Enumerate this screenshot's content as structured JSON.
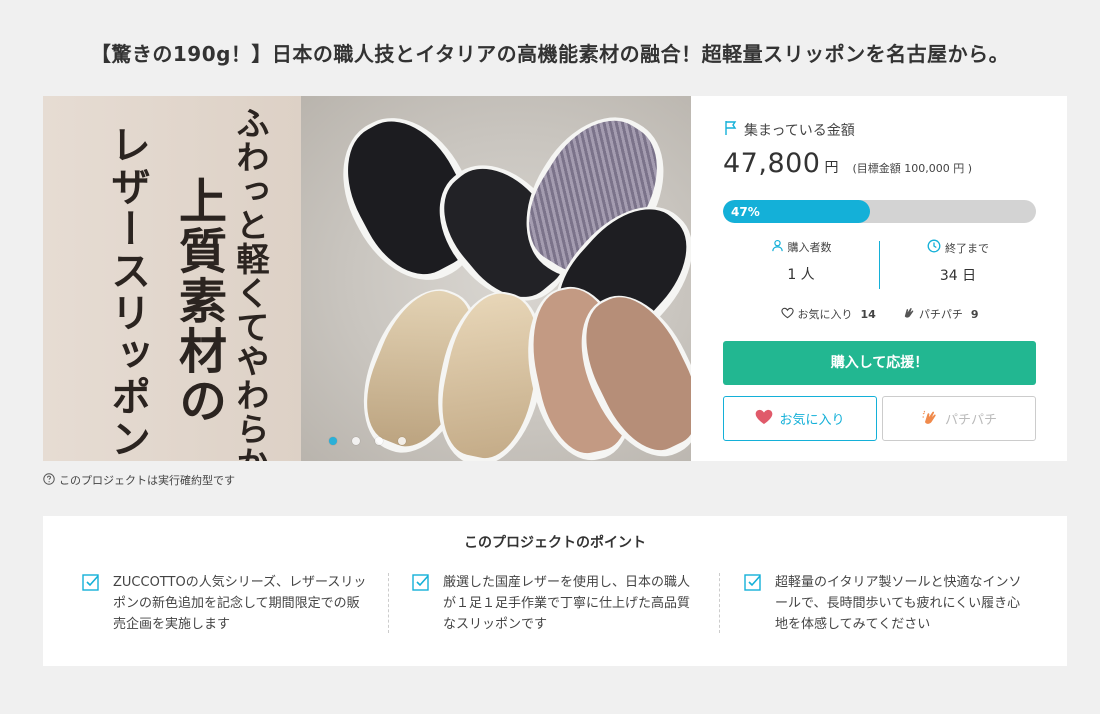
{
  "page_title": "【驚きの190g！】日本の職人技とイタリアの高機能素材の融合！超軽量スリッポンを名古屋から。",
  "hero_image": {
    "catch_line_1": "ふわっと軽くてやわらかい",
    "catch_line_2": "上質素材の",
    "catch_line_3": "レザースリッポン",
    "slide_count": 4,
    "active_slide": 1
  },
  "project_info": {
    "raised_label": "集まっている金額",
    "raised_amount": "47,800",
    "raised_unit": "円",
    "goal_text": "(目標金額 100,000 円 )",
    "progress_percent": 47,
    "progress_label": "47%",
    "supporters_label": "購入者数",
    "supporters_value": "1 人",
    "remaining_label": "終了まで",
    "remaining_value": "34 日",
    "favorite_label": "お気に入り",
    "favorite_count": "14",
    "clap_label": "パチパチ",
    "clap_count": "9",
    "buy_button": "購入して応援！",
    "favorite_button": "お気に入り",
    "clap_button": "パチパチ"
  },
  "execution_note": "このプロジェクトは実行確約型です",
  "points": {
    "title": "このプロジェクトのポイント",
    "items": [
      "ZUCCOTTOの人気シリーズ、レザースリッポンの新色追加を記念して期間限定での販売企画を実施します",
      "厳選した国産レザーを使用し、日本の職人が１足１足手作業で丁寧に仕上げた高品質なスリッポンです",
      "超軽量のイタリア製ソールと快適なインソールで、長時間歩いても疲れにくい履き心地を体感してみてください"
    ]
  },
  "colors": {
    "accent": "#14b0d8",
    "buy": "#22b791",
    "heart": "#e05a6a",
    "clap": "#f08a4b"
  }
}
